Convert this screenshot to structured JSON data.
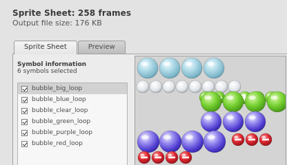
{
  "header": {
    "title": "Sprite Sheet: 258 frames",
    "subtitle": "Output file size: 176 KB"
  },
  "tabs": [
    {
      "label": "Sprite Sheet",
      "active": true
    },
    {
      "label": "Preview",
      "active": false
    }
  ],
  "symbol_info": {
    "heading": "Symbol information",
    "selected_count": "6 symbols selected"
  },
  "symbols": [
    {
      "label": "bubble_big_loop",
      "checked": true,
      "selected": true
    },
    {
      "label": "bubble_blue_loop",
      "checked": true,
      "selected": false
    },
    {
      "label": "bubble_clear_loop",
      "checked": true,
      "selected": false
    },
    {
      "label": "bubble_green_loop",
      "checked": true,
      "selected": false
    },
    {
      "label": "bubble_purple_loop",
      "checked": true,
      "selected": false
    },
    {
      "label": "bubble_red_loop",
      "checked": true,
      "selected": false
    }
  ],
  "sprite_sheet": {
    "frames": [
      {
        "kind": "blue-large",
        "count": 4
      },
      {
        "kind": "clear-small",
        "count": 8
      },
      {
        "kind": "green-small",
        "count": 6
      },
      {
        "kind": "green-large",
        "count": 4
      },
      {
        "kind": "purple-large",
        "count": 3
      },
      {
        "kind": "purple-large",
        "count": 4
      },
      {
        "kind": "red-small",
        "count": 3
      },
      {
        "kind": "red-small",
        "count": 4
      }
    ],
    "colors": {
      "blue": "#8fc6d6",
      "clear": "#d8dde2",
      "green": "#66c92a",
      "purple": "#5f4ad8",
      "red": "#d8202a",
      "background": "#d4d4d4"
    }
  }
}
